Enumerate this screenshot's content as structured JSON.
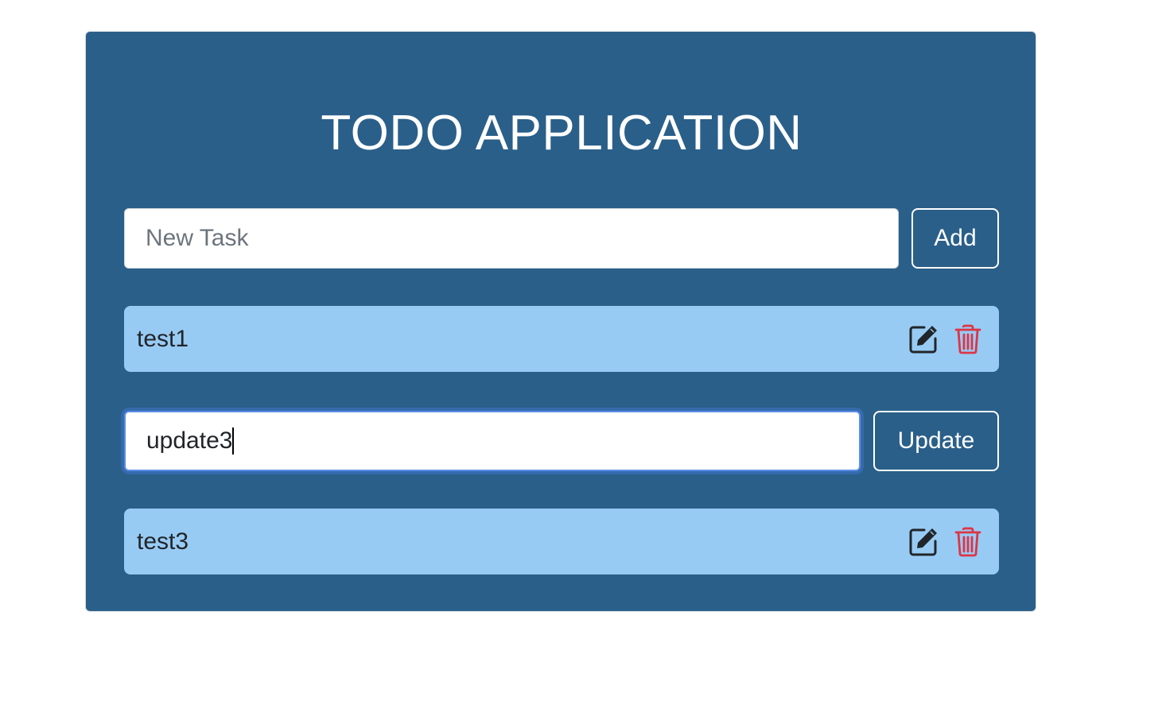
{
  "app": {
    "title": "TODO APPLICATION"
  },
  "new_task": {
    "placeholder": "New Task",
    "value": "",
    "add_label": "Add"
  },
  "tasks": [
    {
      "label": "test1",
      "mode": "view",
      "edit_icon": "edit-icon",
      "delete_icon": "trash-icon"
    },
    {
      "label": "update3",
      "mode": "editing",
      "update_label": "Update"
    },
    {
      "label": "test3",
      "mode": "view",
      "edit_icon": "edit-icon",
      "delete_icon": "trash-icon"
    }
  ],
  "colors": {
    "card_background": "#2a5f89",
    "task_background": "#98cbf4",
    "delete_icon": "#dc3545",
    "edit_icon": "#212529",
    "focus_ring": "#5b8ee6"
  }
}
